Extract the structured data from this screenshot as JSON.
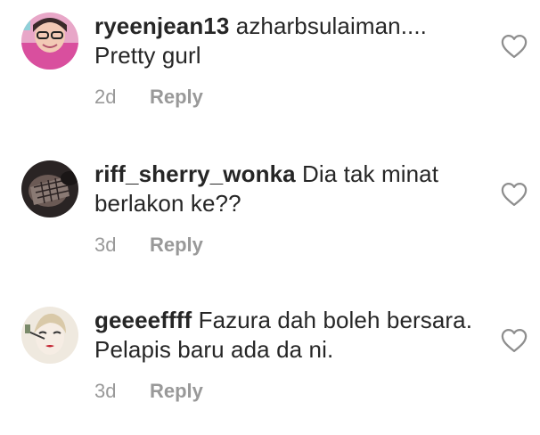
{
  "comments": [
    {
      "username": "ryeenjean13",
      "text": "azharbsulaiman.... Pretty gurl",
      "time": "2d",
      "reply_label": "Reply",
      "avatar_icon": "profile-photo-icon",
      "like_icon": "heart-outline-icon"
    },
    {
      "username": "riff_sherry_wonka",
      "text": "Dia tak minat berlakon ke??",
      "time": "3d",
      "reply_label": "Reply",
      "avatar_icon": "profile-photo-icon",
      "like_icon": "heart-outline-icon"
    },
    {
      "username": "geeeeffff",
      "text": "Fazura dah boleh bersara. Pelapis baru ada da ni.",
      "time": "3d",
      "reply_label": "Reply",
      "avatar_icon": "profile-photo-icon",
      "like_icon": "heart-outline-icon"
    }
  ],
  "colors": {
    "text": "#262626",
    "meta": "#999999",
    "heart": "#8e8e8e"
  }
}
